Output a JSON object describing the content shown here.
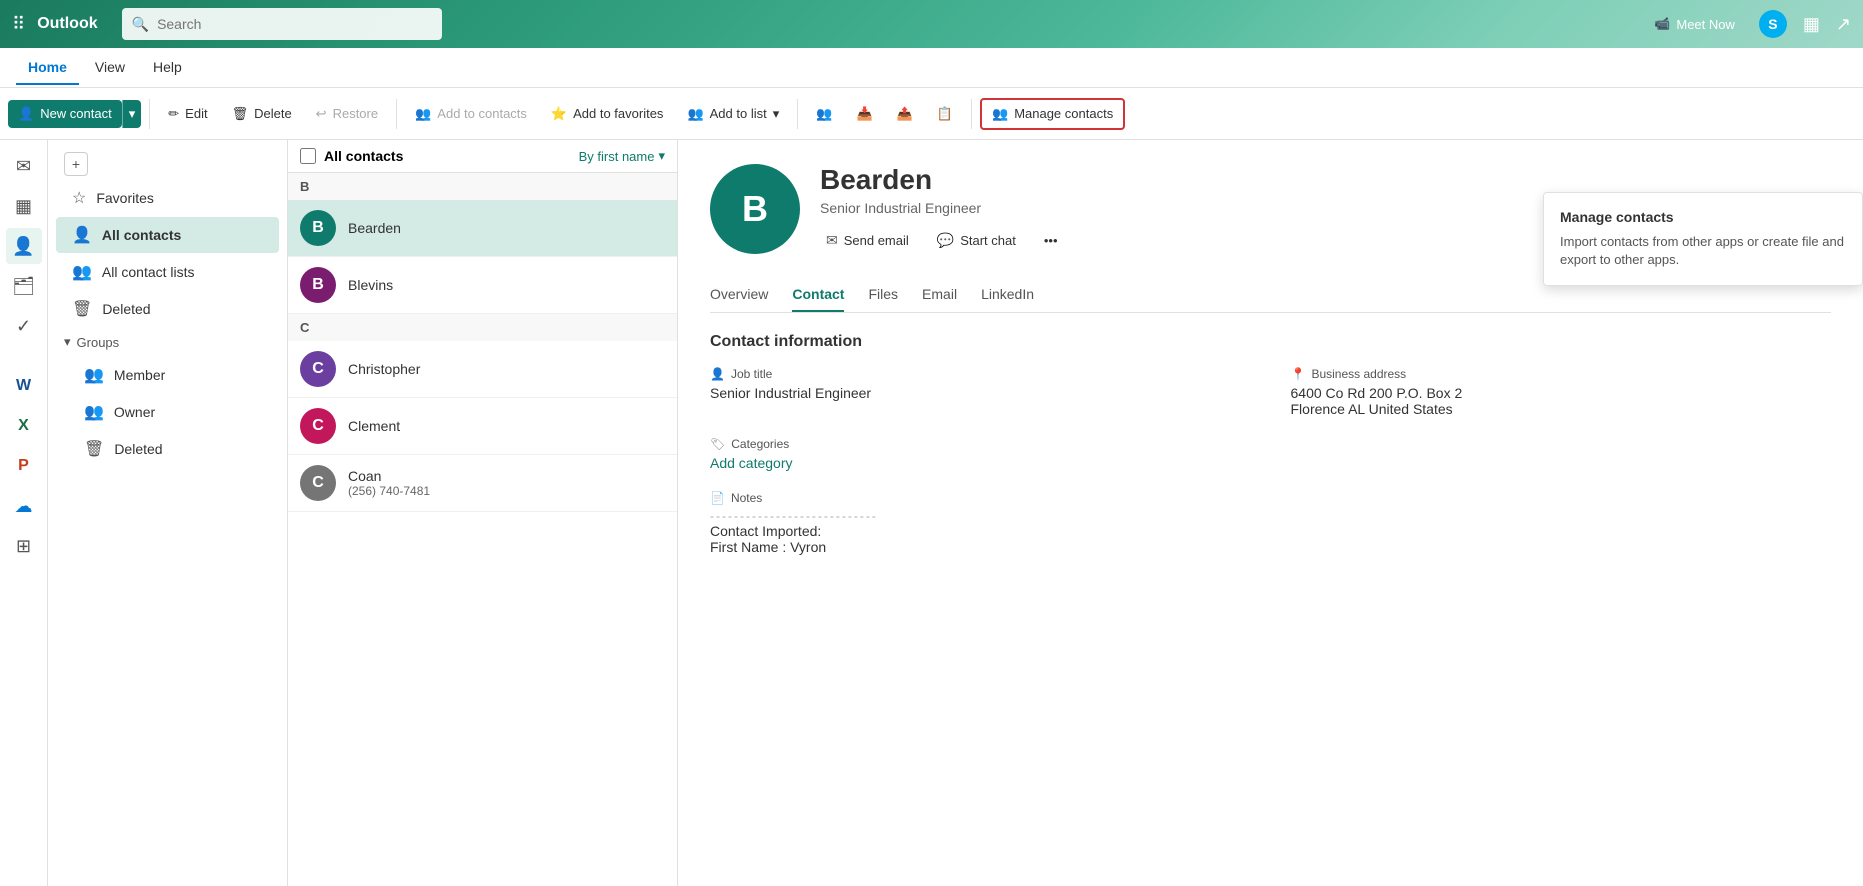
{
  "app": {
    "title": "Outlook",
    "waffle": "⊞"
  },
  "topbar": {
    "search_placeholder": "Search",
    "meet_now": "Meet Now",
    "skype_letter": "S"
  },
  "navbar": {
    "items": [
      {
        "label": "Home",
        "active": true
      },
      {
        "label": "View",
        "active": false
      },
      {
        "label": "Help",
        "active": false
      }
    ]
  },
  "toolbar": {
    "new_contact": "New contact",
    "edit": "Edit",
    "delete": "Delete",
    "restore": "Restore",
    "add_to_contacts": "Add to contacts",
    "add_to_favorites": "Add to favorites",
    "add_to_list": "Add to list",
    "manage_contacts": "Manage contacts"
  },
  "sidebar_icons": [
    {
      "name": "mail-icon",
      "symbol": "✉",
      "active": false
    },
    {
      "name": "calendar-icon",
      "symbol": "▦",
      "active": false
    },
    {
      "name": "people-icon",
      "symbol": "👤",
      "active": true
    },
    {
      "name": "tasks-icon",
      "symbol": "🗂",
      "active": false
    },
    {
      "name": "checkmark-icon",
      "symbol": "✓",
      "active": false
    },
    {
      "name": "word-icon",
      "symbol": "W",
      "active": false
    },
    {
      "name": "excel-icon",
      "symbol": "X",
      "active": false
    },
    {
      "name": "powerpoint-icon",
      "symbol": "P",
      "active": false
    },
    {
      "name": "onedrive-icon",
      "symbol": "☁",
      "active": false
    },
    {
      "name": "apps-icon",
      "symbol": "⊞",
      "active": false
    }
  ],
  "left_panel": {
    "items": [
      {
        "label": "Favorites",
        "icon": "☆",
        "active": false
      },
      {
        "label": "All contacts",
        "icon": "👤",
        "active": true
      },
      {
        "label": "All contact lists",
        "icon": "👥",
        "active": false
      },
      {
        "label": "Deleted",
        "icon": "🗑",
        "active": false
      }
    ],
    "groups_label": "Groups",
    "group_items": [
      {
        "label": "Member",
        "icon": "👥"
      },
      {
        "label": "Owner",
        "icon": "👥"
      },
      {
        "label": "Deleted",
        "icon": "🗑"
      }
    ]
  },
  "contact_list": {
    "title": "All contacts",
    "sort_label": "By first name",
    "groups": [
      {
        "letter": "B",
        "contacts": [
          {
            "name": "Bearden",
            "detail": "",
            "avatar_letter": "B",
            "avatar_color": "#0f7b6c",
            "selected": true
          },
          {
            "name": "Blevins",
            "detail": "",
            "avatar_letter": "B",
            "avatar_color": "#7b1d6f",
            "selected": false
          }
        ]
      },
      {
        "letter": "C",
        "contacts": [
          {
            "name": "Christopher",
            "detail": "",
            "avatar_letter": "C",
            "avatar_color": "#6b3fa0",
            "selected": false
          },
          {
            "name": "Clement",
            "detail": "",
            "avatar_letter": "C",
            "avatar_color": "#c2185b",
            "selected": false
          },
          {
            "name": "Coan",
            "detail": "(256) 740-7481",
            "avatar_letter": "C",
            "avatar_color": "#757575",
            "selected": false
          }
        ]
      }
    ]
  },
  "contact_detail": {
    "avatar_letter": "B",
    "avatar_color": "#0f7b6c",
    "name": "Bearden",
    "job_title": "Senior Industrial Engineer",
    "actions": {
      "send_email": "Send email",
      "start_chat": "Start chat"
    },
    "tabs": [
      {
        "label": "Overview",
        "active": false
      },
      {
        "label": "Contact",
        "active": true
      },
      {
        "label": "Files",
        "active": false
      },
      {
        "label": "Email",
        "active": false
      },
      {
        "label": "LinkedIn",
        "active": false
      }
    ],
    "info_section_title": "Contact information",
    "job_title_label": "Job title",
    "job_title_value": "Senior Industrial Engineer",
    "business_address_label": "Business address",
    "business_address_value": "6400 Co Rd 200 P.O. Box 2",
    "business_address_city": "Florence AL United States",
    "categories_label": "Categories",
    "add_category": "Add category",
    "notes_label": "Notes",
    "notes_dashes": "----------------------------",
    "notes_line1": "Contact Imported:",
    "notes_line2": "First Name : Vyron"
  },
  "manage_contacts_dropdown": {
    "title": "Manage contacts",
    "description": "Import contacts from other apps or create file and export to other apps."
  }
}
